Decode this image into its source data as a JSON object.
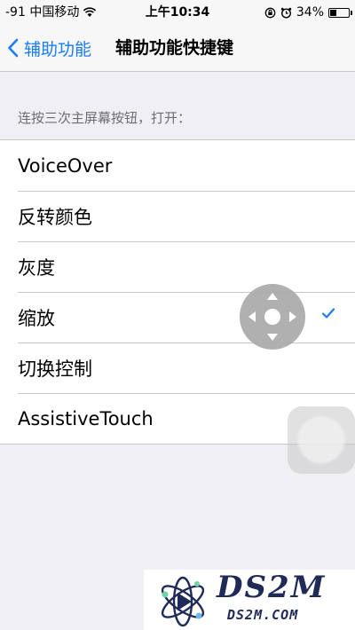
{
  "status_bar": {
    "carrier": "-91 中国移动",
    "time": "上午10:34",
    "battery": "34%",
    "battery_level": 0.34,
    "icons": [
      "wifi-icon",
      "rotation-lock-icon",
      "alarm-icon",
      "battery-icon"
    ]
  },
  "nav": {
    "back_label": "辅助功能",
    "title": "辅助功能快捷键"
  },
  "section": {
    "header": "连按三次主屏幕按钮，打开："
  },
  "options": [
    {
      "label": "VoiceOver",
      "selected": false
    },
    {
      "label": "反转颜色",
      "selected": false
    },
    {
      "label": "灰度",
      "selected": false
    },
    {
      "label": "缩放",
      "selected": true
    },
    {
      "label": "切换控制",
      "selected": false
    },
    {
      "label": "AssistiveTouch",
      "selected": false
    }
  ],
  "watermark": {
    "brand": "DS2M",
    "site": "DS2M.COM"
  },
  "colors": {
    "accent": "#1a7cf6",
    "background": "#efeff4",
    "separator": "#c8c7cc",
    "watermark": "#1f2a57"
  }
}
